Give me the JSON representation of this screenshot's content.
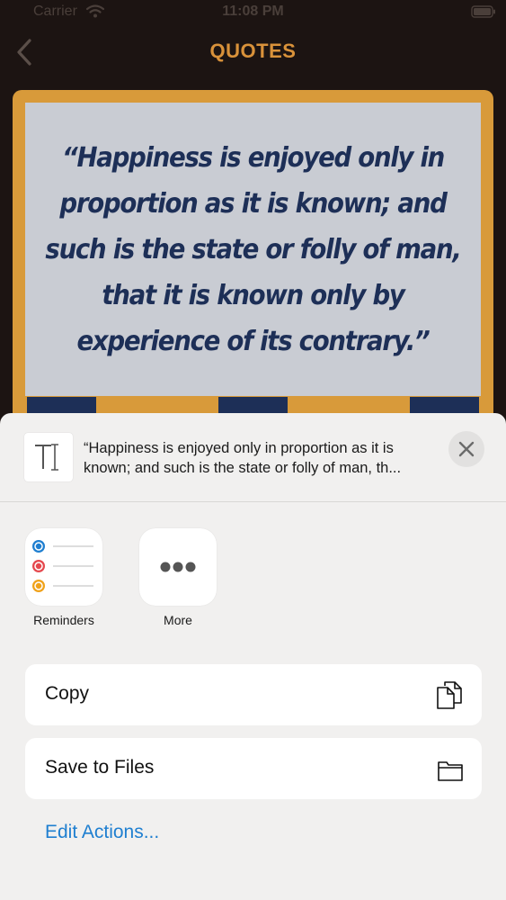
{
  "status_bar": {
    "carrier": "Carrier",
    "time": "11:08 PM",
    "icons": [
      "wifi-icon",
      "battery-icon"
    ]
  },
  "nav": {
    "title": "QUOTES",
    "back_icon": "chevron-left-icon"
  },
  "quote": {
    "text": "“Happiness is enjoyed only in proportion as it is known; and such is the state or folly of man, that it is known only by experience of its contrary.”"
  },
  "share_sheet": {
    "preview_text": "“Happiness is enjoyed only in proportion as it is known; and such is the state or folly of man, th...",
    "preview_icon": "text-type-icon",
    "close_icon": "close-icon",
    "apps": [
      {
        "label": "Reminders",
        "icon": "reminders-icon"
      },
      {
        "label": "More",
        "icon": "more-icon"
      }
    ],
    "actions": [
      {
        "label": "Copy",
        "icon": "copy-icon"
      },
      {
        "label": "Save to Files",
        "icon": "folder-icon"
      }
    ],
    "edit_actions_label": "Edit Actions..."
  },
  "colors": {
    "accent": "#d9923a",
    "quote_text": "#1d2f57",
    "quote_background": "#c9ccd3",
    "card_border": "#d89a3a",
    "link": "#1f7fd0",
    "reminder_dots": [
      "#1f7fd0",
      "#e5484d",
      "#f0a21a"
    ]
  }
}
